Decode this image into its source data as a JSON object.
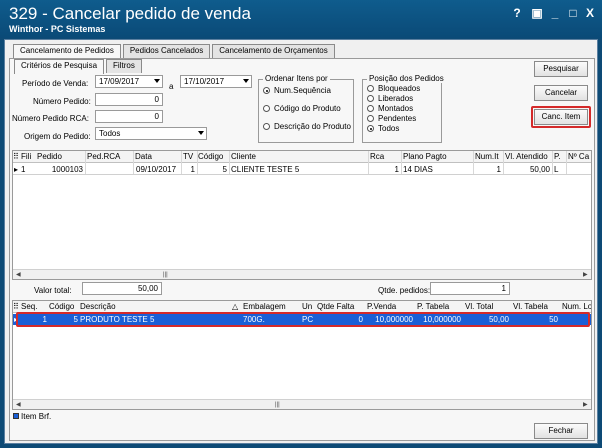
{
  "window": {
    "title": "329 - Cancelar pedido de venda",
    "subtitle": "Winthor - PC Sistemas",
    "controls": [
      "?",
      "▣",
      "_",
      "□",
      "X"
    ]
  },
  "tabs": [
    "Cancelamento de Pedidos",
    "Pedidos Cancelados",
    "Cancelamento de Orçamentos"
  ],
  "subtabs": [
    "Critérios de Pesquisa",
    "Filtros"
  ],
  "criteria": {
    "periodo_label": "Período de Venda:",
    "date_from": "17/09/2017",
    "date_sep": "a",
    "date_to": "17/10/2017",
    "numero_label": "Número Pedido:",
    "numero_value": "0",
    "rca_label": "Número Pedido RCA:",
    "rca_value": "0",
    "origem_label": "Origem do Pedido:",
    "origem_value": "Todos"
  },
  "ordenar": {
    "title": "Ordenar Itens por",
    "options": [
      "Num.Sequência",
      "Código do Produto",
      "Descrição do Produto"
    ],
    "selected": 0
  },
  "posicao": {
    "title": "Posição dos Pedidos",
    "options": [
      "Bloqueados",
      "Liberados",
      "Montados",
      "Pendentes",
      "Todos"
    ],
    "selected": 4
  },
  "buttons": {
    "pesquisar": "Pesquisar",
    "cancelar": "Cancelar",
    "canc_item": "Canc. Item",
    "fechar": "Fechar"
  },
  "orders": {
    "headers": [
      "Fili",
      "Pedido",
      "Ped.RCA",
      "Data",
      "TV",
      "Código",
      "Cliente",
      "Rca",
      "Plano Pagto",
      "Num.It",
      "Vl. Atendido",
      "P.",
      "Nº Ca"
    ],
    "rows": [
      [
        "1",
        "1000103",
        "",
        "09/10/2017",
        "1",
        "5",
        "CLIENTE TESTE 5",
        "1",
        "14 DIAS",
        "1",
        "50,00",
        "L",
        ""
      ]
    ]
  },
  "totals": {
    "valor_label": "Valor total:",
    "valor_value": "50,00",
    "qtde_label": "Qtde. pedidos:",
    "qtde_value": "1"
  },
  "items": {
    "headers": [
      "Seq.",
      "Código",
      "Descrição",
      "Embalagem",
      "Un",
      "Qtde Falta",
      "P.Venda",
      "P. Tabela",
      "Vl. Total",
      "Vl. Tabela",
      "Num. Lo"
    ],
    "rows": [
      [
        "1",
        "5",
        "PRODUTO TESTE 5",
        "700G.",
        "PC",
        "0",
        "10,000000",
        "10,000000",
        "50,00",
        "50",
        ""
      ]
    ]
  },
  "legend": {
    "item_brf": "Item Brf."
  },
  "colors": {
    "titlebar": "#0d4a75",
    "selection": "#1a5fd6",
    "highlight": "#d42a2a"
  }
}
